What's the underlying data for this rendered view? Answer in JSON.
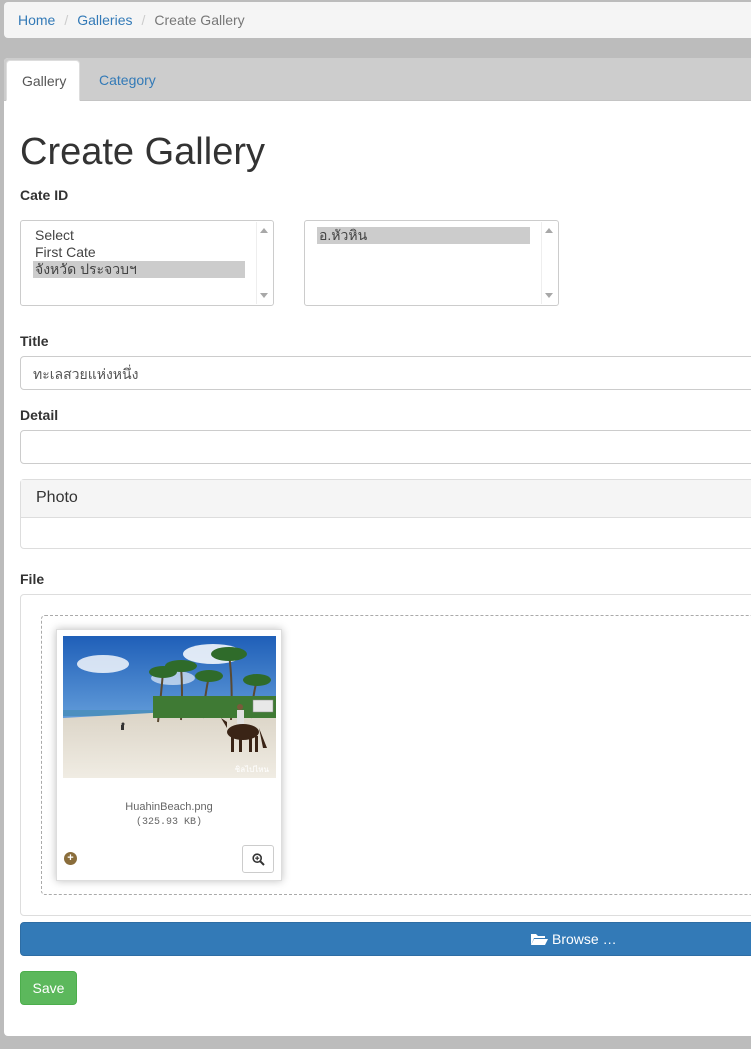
{
  "breadcrumb": {
    "home": "Home",
    "galleries": "Galleries",
    "current": "Create Gallery"
  },
  "tabs": {
    "gallery": "Gallery",
    "category": "Category"
  },
  "page": {
    "title": "Create Gallery"
  },
  "form": {
    "cate_id_label": "Cate ID",
    "cate_select": {
      "options": [
        "Select",
        "First Cate",
        "จังหวัด ประจวบฯ"
      ],
      "selected": "จังหวัด ประจวบฯ"
    },
    "sub_select": {
      "options": [
        "อ.หัวหิน"
      ],
      "selected": "อ.หัวหิน"
    },
    "title_label": "Title",
    "title_value": "ทะเลสวยแห่งหนึ่ง",
    "detail_label": "Detail",
    "detail_value": "",
    "photo_heading": "Photo",
    "file_label": "File",
    "file": {
      "name": "HuahinBeach.png",
      "size": "(325.93 KB)",
      "watermark": "ชิลไปไหน"
    },
    "browse_label": "Browse …",
    "save_label": "Save"
  },
  "icons": {
    "add": "plus-circle-icon",
    "zoom": "zoom-in-icon",
    "folder": "folder-open-icon"
  },
  "colors": {
    "primary": "#337ab7",
    "success": "#5cb85c",
    "add_icon": "#8a6d3b"
  }
}
